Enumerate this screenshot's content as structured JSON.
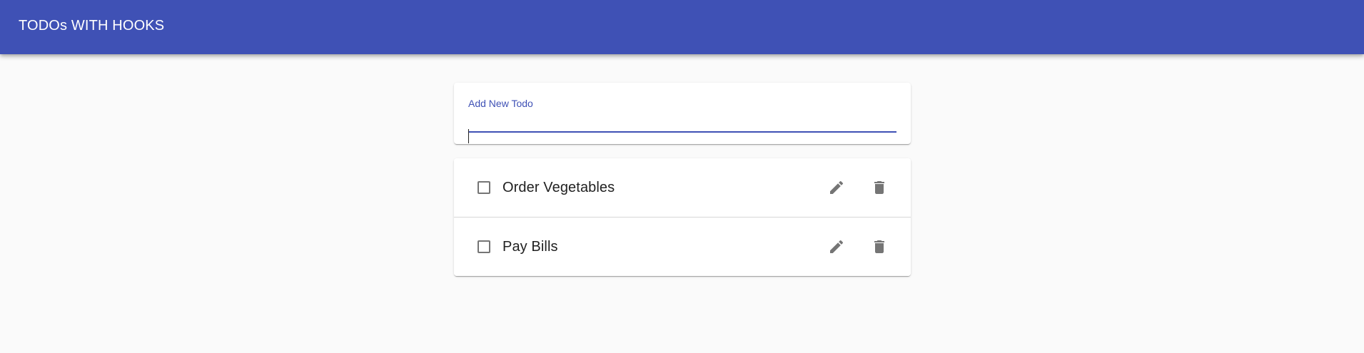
{
  "appbar": {
    "title": "TODOs WITH HOOKS",
    "color": "#3f51b5"
  },
  "form": {
    "label": "Add New Todo",
    "value": ""
  },
  "todos": [
    {
      "task": "Order Vegetables",
      "completed": false,
      "edit_icon": "pencil-icon",
      "delete_icon": "trash-icon"
    },
    {
      "task": "Pay Bills",
      "completed": false,
      "edit_icon": "pencil-icon",
      "delete_icon": "trash-icon"
    }
  ],
  "colors": {
    "primary": "#3f51b5",
    "background": "#fafafa",
    "icon": "#757575"
  }
}
